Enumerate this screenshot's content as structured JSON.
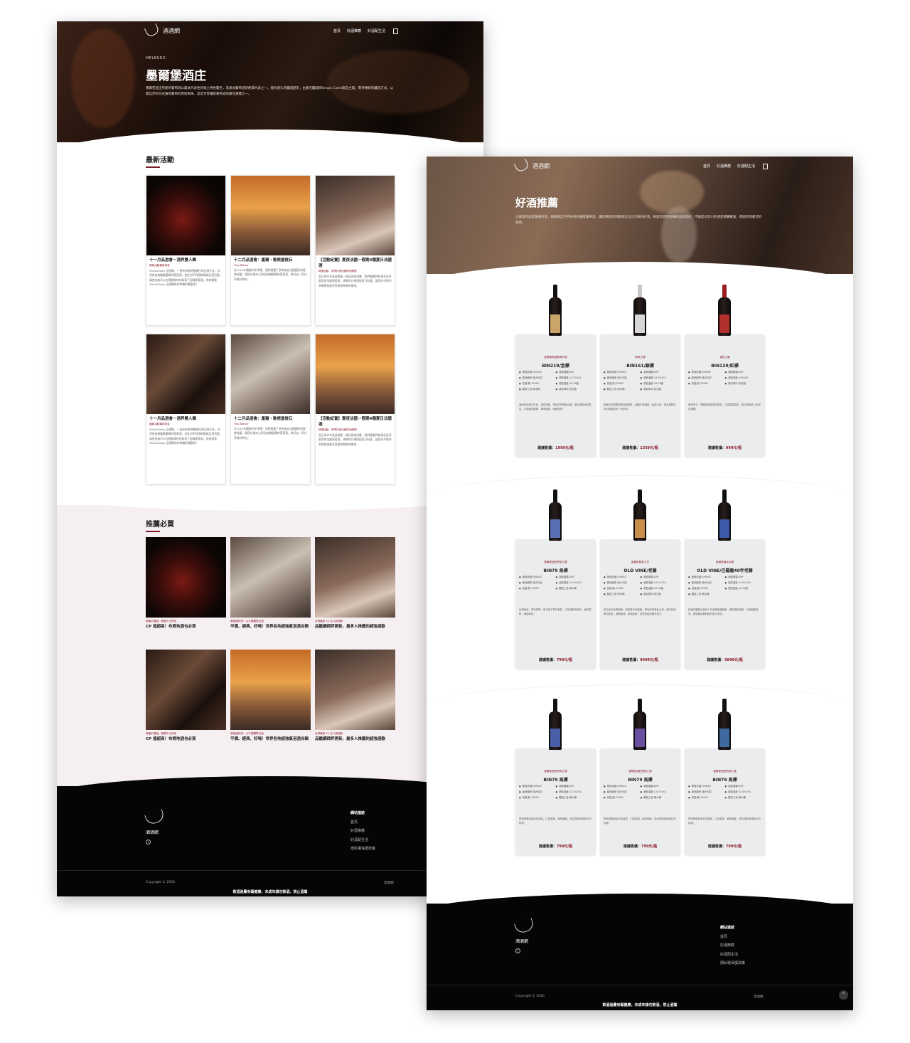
{
  "site": {
    "logo_text": "酒酒網",
    "nav": [
      "首頁",
      "好酒推薦",
      "好酒配生活"
    ]
  },
  "winery": {
    "eyebrow": "MELBURG",
    "title": "墨爾堡酒庄",
    "lead": "墨爾堡酒庄所產的葡萄酒以最具代表性的風土特色聞名，為澳洲葡萄酒的經典代表之一。擁有悠久的釀酒歷史，由著名釀酒師Sergio Carlei親自主理，秉持傳統的釀造方式，以最自然的方式展現葡萄的原始風味，是您享受優質葡萄酒的最佳選擇之一。"
  },
  "events": {
    "title": "最新活動",
    "cards": [
      {
        "title": "十一月品酒會－酒界雙人舞",
        "meta": "最新活動最新消息",
        "text": "Wine&Taste 品酒網，一直有系統地推廣在地品酒文化，向消費者推薦最優質的葡萄酒，並針對不同酒款舉辦品酒活動，讓參加者可以在輕鬆愉快的氣氛下認識葡萄酒。快來看看Wine&Taste 品酒網為你準備的饗宴吧！"
      },
      {
        "title": "十二月品酒會：墨爾・勒根堡復丘",
        "meta": "Trey Bittner",
        "text": "在2019年最後的冬季裡，我們挑選了多款來自法國產區的經典佳釀，讓您在歲末之際品味最優雅的葡萄酒，與好友一同分享美好時光。"
      },
      {
        "title": "【活動紀實】夏夜法國－假期4種夏日法國酒",
        "meta": "精選活動．夏季好酒法國好酒推薦",
        "text": "夏日的炎炎氣候需要一瓶好酒來消暑，我們精選四款適合夏季飲用的法國葡萄酒，清爽的口感搭配夏日料理，讓您在炎熱的季節裡也能享受美酒帶來的愉悅。"
      },
      {
        "title": "十一月品酒會－酒界雙人舞",
        "meta": "最新活動最新消息",
        "text": "Wine&Taste 品酒網，一直有系統地推廣在地品酒文化，向消費者推薦最優質的葡萄酒，並針對不同酒款舉辦品酒活動，讓參加者可以在輕鬆愉快的氣氛下認識葡萄酒。快來看看Wine&Taste 品酒網為你準備的饗宴吧！"
      },
      {
        "title": "十二月品酒會：墨爾・勒根堡復丘",
        "meta": "Trey Bittner",
        "text": "在2019年最後的冬季裡，我們挑選了多款來自法國產區的經典佳釀，讓您在歲末之際品味最優雅的葡萄酒，與好友一同分享美好時光。"
      },
      {
        "title": "【活動紀實】夏夜法國－假期4種夏日法國酒",
        "meta": "精選活動．夏季好酒法國好酒推薦",
        "text": "夏日的炎炎氣候需要一瓶好酒來消暑，我們精選四款適合夏季飲用的法國葡萄酒，清爽的口感搭配夏日料理，讓您在炎熱的季節裡也能享受美酒帶來的愉悅。"
      }
    ]
  },
  "picks": {
    "title": "推薦必買",
    "cards": [
      {
        "tag": "超值平價酒，精選千元有找",
        "title": "CP 值超高！布根地酒也必買"
      },
      {
        "tag": "葡萄酒好評！以平價購買佳酒",
        "title": "平價、經典、好喝！世界各地超強氣泡酒合輯"
      },
      {
        "tag": "全球最新 20 名人氣酒款",
        "title": "品鑑網師評更新，最多人推薦的超強酒款"
      },
      {
        "tag": "超值平價酒，精選千元有找",
        "title": "CP 值超高！布根地酒也必買"
      },
      {
        "tag": "葡萄酒好評！以平價購買佳酒",
        "title": "平價、經典、好喝！世界各地超強氣泡酒合輯"
      },
      {
        "tag": "全球最新 20 名人氣酒款",
        "title": "品鑑網師評更新，最多人推薦的超強酒款"
      }
    ]
  },
  "footer": {
    "logo_text": "酒酒網",
    "links_title": "網站連結",
    "links": [
      "首頁",
      "好酒推薦",
      "好酒配生活",
      "隱私權保護政策"
    ],
    "copyright": "Copyright © 2020",
    "site_right": "酒酒網",
    "warning": "飲酒過量有礙健康，未成年請勿飲酒，禁止酒駕"
  },
  "recommend": {
    "title": "好酒推薦",
    "lead": "以專業的角度嚴選好酒，推薦來自世界各地的優質葡萄酒，讓您輕鬆找到最適合自己口味的好酒。每款酒皆附詳細的品飲資訊，不論是日常小酌或是節慶聚會，都能找到最佳的選擇。",
    "price_label": "建議售價："
  },
  "wines": [
    {
      "sub": "紐澳葡萄酒經典代表",
      "name": "BIN219/金標",
      "specs": [
        "葡萄品種:SHIRAZ",
        "酒款種類:DRY",
        "產地國家:澳大利亞",
        "酒精濃度:14.5%VOL",
        "容量/瓶:750ML",
        "適飲溫度:16-18度",
        "釀造工藝:橡木桶",
        "儲存條件:陰涼處"
      ],
      "desc": "酒液呈深寶石紅色，香氣濃郁，帶有成熟黑色水果、香料與橡木的氣息，口感飽滿圓潤，單寧細緻，餘韻悠長。",
      "price": "1999元/瓶",
      "label": "#c9a56a"
    },
    {
      "sub": "時尚之選",
      "name": "BIN161/銀標",
      "specs": [
        "葡萄品種:SHIRAZ",
        "酒款種類:DRY",
        "產地國家:澳大利亞",
        "酒精濃度:14.5%VOL",
        "容量/瓶:750ML",
        "適飲溫度:16-18度",
        "釀造工藝:橡木桶",
        "儲存條件:陰涼處"
      ],
      "desc": "散發紅色莓果與黑胡椒香氣，酒體中等偏重，結構平衡，適合搭配紅肉料理或起司一同享用。",
      "price": "1359元/瓶",
      "label": "#d6d6d6"
    },
    {
      "sub": "酒莊之最",
      "name": "BIN129/紅標",
      "specs": [
        "葡萄品種:SHIRAZ",
        "酒款種類:DRY",
        "產地國家:澳大利亞",
        "酒精濃度:14%VOL",
        "容量/瓶:750ML",
        "儲存條件:陰涼處"
      ],
      "desc": "帶有李子、黑櫻桃與香草的香氣，口感柔順易飲，是日常餐桌上的絕佳選擇。",
      "price": "999元/瓶",
      "label": "#b0302c"
    },
    {
      "sub": "墨爾堡酒莊熱銷之選",
      "name": "BIN79 馬標",
      "specs": [
        "葡萄品種:SHIRAZ",
        "酒款種類:DRY",
        "產地國家:澳大利亞",
        "酒精濃度:14.5%VOL",
        "容量/瓶:750ML",
        "釀造工藝:橡木桶"
      ],
      "desc": "色澤深邃，帶有黑莓、摩卡與甘草的香氣，口感濃郁有層次，單寧柔和，餘韻綿長。",
      "price": "799元/瓶",
      "label": "#5a6fb3"
    },
    {
      "sub": "墨爾堡經典之作",
      "name": "OLD VINE/老藤",
      "specs": [
        "葡萄品種:SHIRAZ",
        "酒款種類:DRY",
        "產地國家:澳大利亞",
        "酒精濃度:14.5%VOL",
        "容量/瓶:750ML",
        "適飲溫度:16-18度",
        "釀造工藝:橡木桶",
        "儲存條件:陰涼處"
      ],
      "desc": "來自百年老藤葡萄，香氣集中而複雜，帶有成熟黑色水果、香料與皮革的氣息，酒體飽滿，結構紮實，具有極佳的陳年潛力。",
      "price": "9999元/瓶",
      "label": "#c98f4a"
    },
    {
      "sub": "墨爾堡最佳珍藏",
      "name": "OLD VINE/巴羅薩40年老藤",
      "specs": [
        "葡萄品種:SHIRAZ",
        "酒款種類:DRY",
        "產地國家:澳大利亞",
        "酒精濃度:14.5%VOL",
        "容量/瓶:750ML",
        "適飲溫度:16-18度",
        "釀造工藝:橡木桶"
      ],
      "desc": "精選巴羅薩谷地四十年老藤葡萄釀造，香氣濃郁優雅，口感細緻綿密，展現產區最純粹的風土特色。",
      "price": "5899元/瓶",
      "label": "#3c5aa8"
    },
    {
      "sub": "墨爾堡酒莊熱銷之選",
      "name": "BIN79 馬標",
      "specs": [
        "葡萄品種:SHIRAZ",
        "酒款種類:DRY",
        "產地國家:澳大利亞",
        "酒精濃度:13.5%VOL",
        "容量/瓶:750ML",
        "釀造工藝:橡木桶"
      ],
      "desc": "帶有黑莓與香料的香氣，口感柔順，單寧細緻，適合搭配燒烤與紅肉料理。",
      "price": "799元/瓶",
      "label": "#4a5fa8"
    },
    {
      "sub": "墨爾堡酒莊熱銷之選",
      "name": "BIN79 馬標",
      "specs": [
        "葡萄品種:SHIRAZ",
        "酒款種類:DRY",
        "產地國家:澳大利亞",
        "酒精濃度:13.5%VOL",
        "容量/瓶:750ML",
        "釀造工藝:橡木桶"
      ],
      "desc": "帶有黑莓與香料的香氣，口感柔順，單寧細緻，適合搭配燒烤與紅肉料理。",
      "price": "799元/瓶",
      "label": "#6a4fa0"
    },
    {
      "sub": "墨爾堡酒莊熱銷之選",
      "name": "BIN79 馬標",
      "specs": [
        "葡萄品種:SHIRAZ",
        "酒款種類:DRY",
        "產地國家:澳大利亞",
        "酒精濃度:13.5%VOL",
        "容量/瓶:750ML",
        "釀造工藝:橡木桶"
      ],
      "desc": "帶有黑莓與香料的香氣，口感柔順，單寧細緻，適合搭配燒烤與紅肉料理。",
      "price": "799元/瓶",
      "label": "#3e6aa0"
    }
  ]
}
